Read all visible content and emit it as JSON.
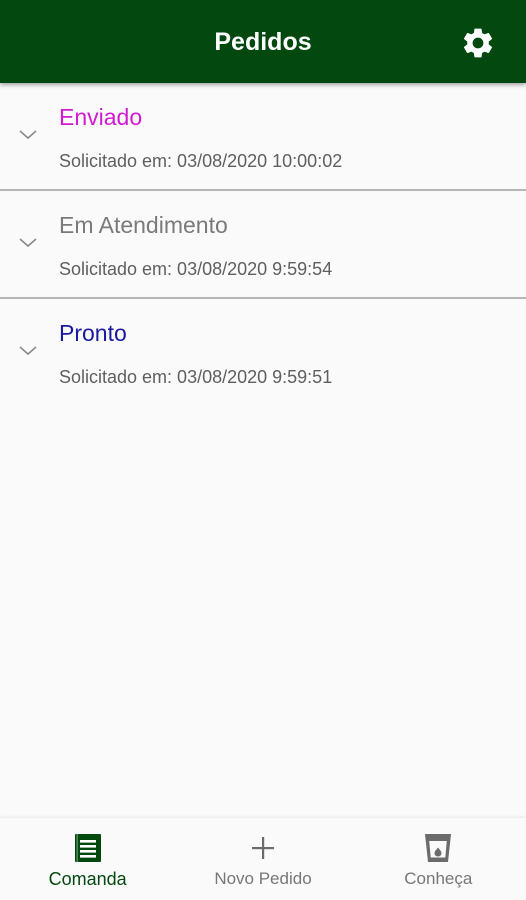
{
  "appbar": {
    "title": "Pedidos",
    "settings_icon": "gear-icon"
  },
  "orders": [
    {
      "status": "Enviado",
      "status_color": "#d21ad2",
      "requested": "Solicitado em: 03/08/2020 10:00:02"
    },
    {
      "status": "Em Atendimento",
      "status_color": "#7a7a7a",
      "requested": "Solicitado em: 03/08/2020 9:59:54"
    },
    {
      "status": "Pronto",
      "status_color": "#1a1aa0",
      "requested": "Solicitado em: 03/08/2020 9:59:51"
    }
  ],
  "navbar": {
    "items": [
      {
        "label": "Comanda",
        "icon": "receipt-icon",
        "active": true
      },
      {
        "label": "Novo Pedido",
        "icon": "plus-icon",
        "active": false
      },
      {
        "label": "Conheça",
        "icon": "cup-icon",
        "active": false
      }
    ]
  },
  "colors": {
    "primary": "#02480f",
    "background": "#fafafa",
    "divider": "#b5b5b5",
    "inactive": "#777777"
  }
}
